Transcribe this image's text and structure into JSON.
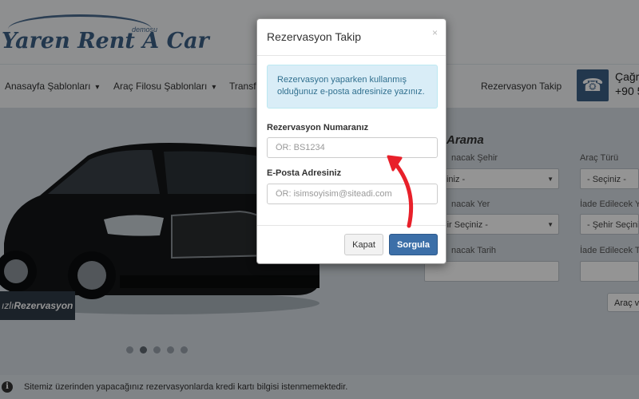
{
  "logo": {
    "brand": "Yaren Rent A Car",
    "sub": "demosu"
  },
  "nav": {
    "items": [
      "Anasayfa Şablonları",
      "Araç Filosu Şablonları",
      "Transf",
      "Rezervasyon Takip"
    ],
    "chevron": "▾",
    "phone_label": "Çağr",
    "phone_number": "+90 5"
  },
  "hero": {
    "badge_prefix": "ızlı",
    "badge_main": "Rezervasyon",
    "slides": 5,
    "active_slide": 2
  },
  "search_form": {
    "title": "Arama",
    "fields": [
      {
        "label": "nacak Şehir",
        "value": "Seçiniz -"
      },
      {
        "label": "Araç Türü",
        "value": "- Seçiniz -"
      },
      {
        "label": "nacak Yer",
        "value": "Şehir Seçiniz -"
      },
      {
        "label": "İade Edilecek Y",
        "value": "- Şehir Seçiniz -"
      },
      {
        "label": "nacak Tarih",
        "value": ""
      },
      {
        "label": "İade Edilecek T",
        "value": ""
      }
    ],
    "search_button": "Araç v"
  },
  "footer": {
    "notice": "Sitemiz üzerinden yapacağınız rezervasyonlarda kredi kartı bilgisi istenmemektedir."
  },
  "modal": {
    "title": "Rezervasyon Takip",
    "close_symbol": "×",
    "info": "Rezervasyon yaparken kullanmış olduğunuz e-posta adresinize yazınız.",
    "reservation_label": "Rezervasyon Numaranız",
    "reservation_placeholder": "ÖR: BS1234",
    "email_label": "E-Posta Adresiniz",
    "email_placeholder": "ÖR: isimsoyisim@siteadi.com",
    "cancel_button": "Kapat",
    "submit_button": "Sorgula"
  },
  "colors": {
    "primary": "#3c6fa8",
    "info_bg": "#d9edf7",
    "info_text": "#31708f",
    "annotation_arrow": "#e8202a"
  }
}
